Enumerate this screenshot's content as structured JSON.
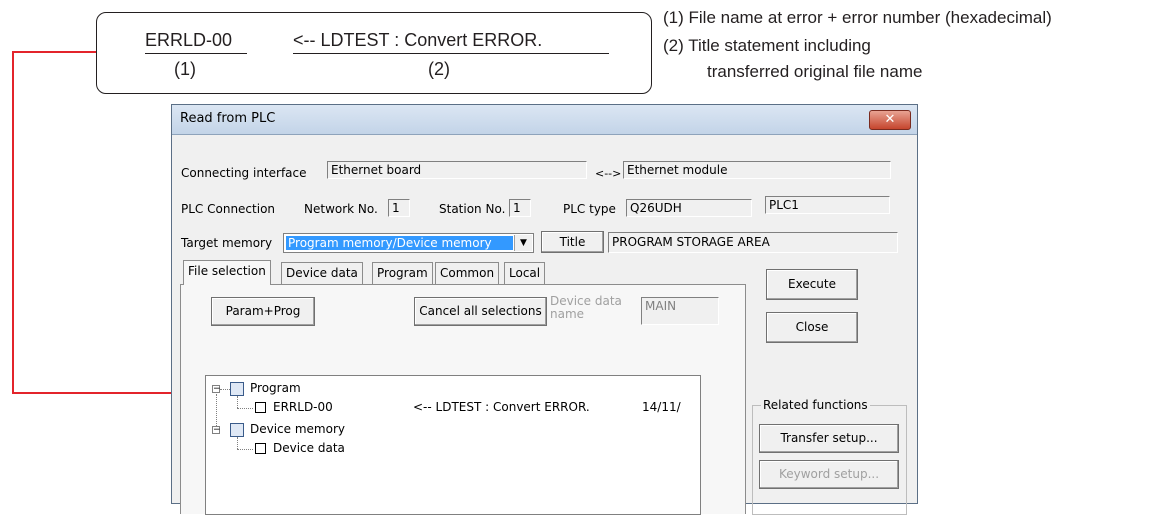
{
  "callout": {
    "filename": "ERRLD-00",
    "arrow_text": "<--  LDTEST : Convert ERROR.",
    "marker1": "(1)",
    "marker2": "(2)"
  },
  "notes": {
    "line1": "(1) File name at error + error number (hexadecimal)",
    "line2": "(2) Title statement including",
    "line3": "transferred original file name"
  },
  "colors": {
    "annotation_line": "#e3242b",
    "selection": "#3399ff"
  },
  "window": {
    "title": "Read from PLC",
    "close_icon": "close-icon",
    "connecting_interface_label": "Connecting interface",
    "connecting_interface_value": "Ethernet board",
    "connect_arrow": "<-->",
    "connected_module_value": "Ethernet module",
    "plc_connection_label": "PLC Connection",
    "network_no_label": "Network No.",
    "network_no_value": "1",
    "station_no_label": "Station No.",
    "station_no_value": "1",
    "plc_type_label": "PLC type",
    "plc_type_value": "Q26UDH",
    "plc_name_value": "PLC1",
    "target_memory_label": "Target memory",
    "target_memory_value": "Program memory/Device memory",
    "title_button": "Title",
    "title_value": "PROGRAM STORAGE AREA",
    "tabs": [
      "File selection",
      "Device data",
      "Program",
      "Common",
      "Local"
    ],
    "param_prog_button": "Param+Prog",
    "cancel_all_button": "Cancel all selections",
    "device_data_name_label": "Device data name",
    "device_data_name_value": "MAIN",
    "execute_button": "Execute",
    "close_button": "Close",
    "related_functions_label": "Related functions",
    "transfer_setup_button": "Transfer setup...",
    "keyword_setup_button": "Keyword setup...",
    "tree": {
      "program": "Program",
      "file_name": "ERRLD-00",
      "file_title": "<-- LDTEST : Convert ERROR.",
      "file_date": "14/11/",
      "device_memory": "Device memory",
      "device_data": "Device data"
    }
  }
}
